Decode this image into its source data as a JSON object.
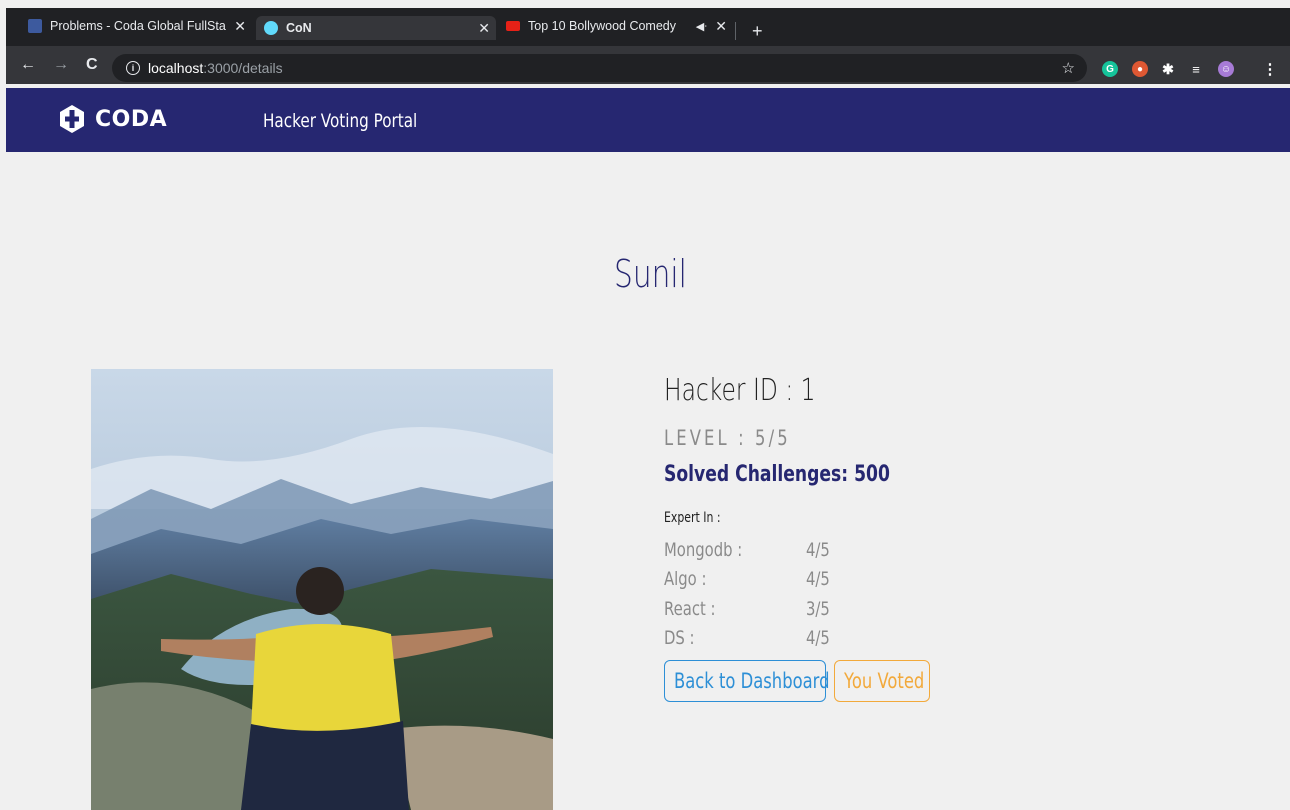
{
  "browser": {
    "tabs": [
      {
        "title": "Problems - Coda Global FullSta"
      },
      {
        "title": "CoN"
      },
      {
        "title": "Top 10 Bollywood Comedy"
      }
    ],
    "url_host": "localhost",
    "url_path": ":3000/details"
  },
  "header": {
    "logo_text": "CODA",
    "title": "Hacker Voting Portal"
  },
  "profile": {
    "name": "Sunil",
    "hacker_id": "Hacker ID : 1",
    "level": "LEVEL : 5/5",
    "solved": "Solved Challenges: 500",
    "expert_label": "Expert In :",
    "skills": [
      {
        "name": "Mongodb :",
        "rating": "4/5"
      },
      {
        "name": "Algo :",
        "rating": "4/5"
      },
      {
        "name": "React :",
        "rating": "3/5"
      },
      {
        "name": "DS :",
        "rating": "4/5"
      }
    ]
  },
  "actions": {
    "back_label": "Back to Dashboard",
    "vote_label": "You Voted"
  },
  "colors": {
    "header_bg": "#262771",
    "back_button": "#2d8fd6",
    "vote_button": "#f2a93b"
  }
}
